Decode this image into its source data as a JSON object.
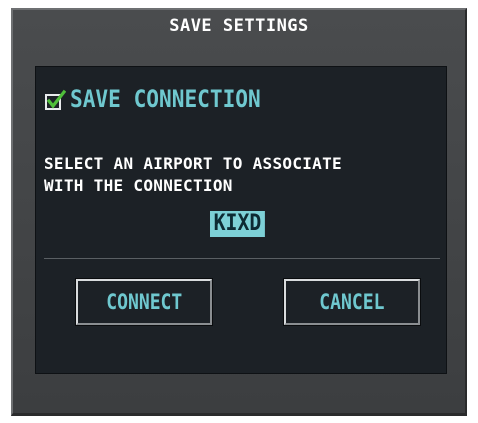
{
  "dialog": {
    "title": "SAVE SETTINGS",
    "save_connection_label": "SAVE CONNECTION",
    "save_connection_checked": true,
    "prompt_line1": "SELECT AN AIRPORT TO ASSOCIATE",
    "prompt_line2": "WITH THE CONNECTION",
    "airport_value": "KIXD",
    "connect_label": "CONNECT",
    "cancel_label": "CANCEL"
  },
  "colors": {
    "accent_cyan": "#6fc8cf",
    "highlight": "#7dd0d6",
    "checkmark": "#4fbf3a",
    "panel_bg": "#1c2126"
  },
  "icons": {
    "checkbox": "checkbox-checked-icon"
  }
}
